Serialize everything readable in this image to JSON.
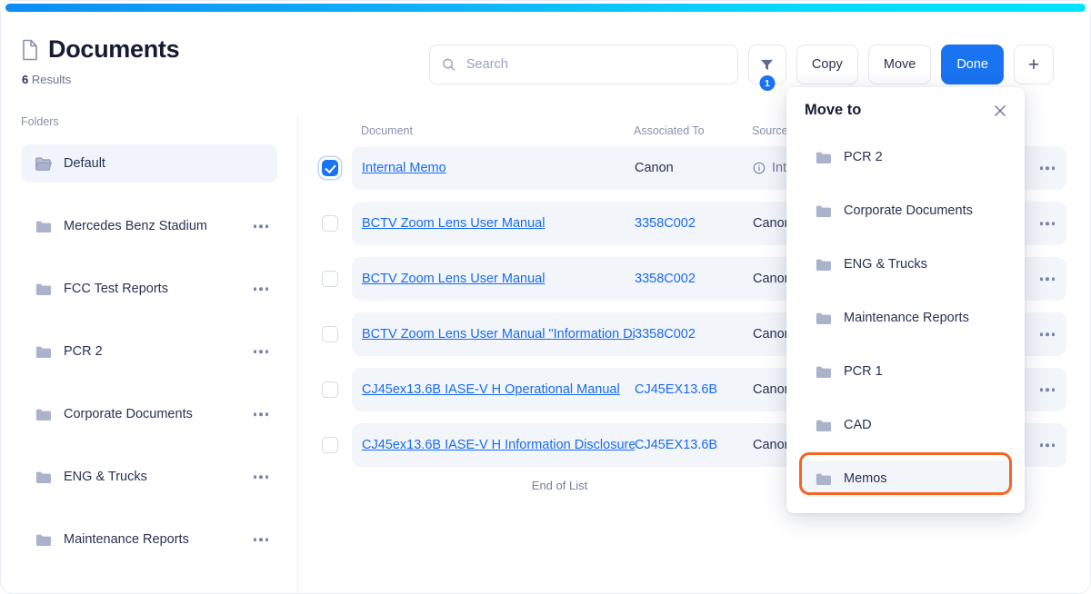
{
  "theme": {
    "accent_blue": "#1a73f0",
    "link_blue": "#1a6bf0",
    "highlight_orange": "#f26522",
    "row_bg": "#f2f5fa",
    "gradient_from": "#0d8df4",
    "gradient_to": "#00e5ff"
  },
  "header": {
    "title": "Documents",
    "results_count": "6",
    "results_label": "Results",
    "doc_icon": "document-icon"
  },
  "toolbar": {
    "search_placeholder": "Search",
    "search_value": "",
    "search_icon": "search-icon",
    "filter_icon": "filter-icon",
    "filter_badge": "1",
    "copy_label": "Copy",
    "move_label": "Move",
    "done_label": "Done",
    "add_label": "+"
  },
  "sidebar": {
    "label": "Folders",
    "items": [
      {
        "label": "Default",
        "active": true,
        "has_menu": false,
        "icon": "folder-open-icon"
      },
      {
        "label": "Mercedes Benz Stadium",
        "active": false,
        "has_menu": true,
        "icon": "folder-icon"
      },
      {
        "label": "FCC Test Reports",
        "active": false,
        "has_menu": true,
        "icon": "folder-icon"
      },
      {
        "label": "PCR 2",
        "active": false,
        "has_menu": true,
        "icon": "folder-icon"
      },
      {
        "label": "Corporate Documents",
        "active": false,
        "has_menu": true,
        "icon": "folder-icon"
      },
      {
        "label": "ENG & Trucks",
        "active": false,
        "has_menu": true,
        "icon": "folder-icon"
      },
      {
        "label": "Maintenance Reports",
        "active": false,
        "has_menu": true,
        "icon": "folder-icon"
      }
    ]
  },
  "table": {
    "columns": {
      "document": "Document",
      "associated_to": "Associated To",
      "source": "Source"
    },
    "rows": [
      {
        "checked": true,
        "document": "Internal Memo",
        "associated_to": "Canon",
        "associated_is_link": false,
        "source": "Internal",
        "source_icon": "info-circle-icon",
        "source_muted": true
      },
      {
        "checked": false,
        "document": "BCTV Zoom Lens User Manual",
        "associated_to": "3358C002",
        "associated_is_link": true,
        "source": "Canon",
        "source_icon": "",
        "source_muted": false
      },
      {
        "checked": false,
        "document": "BCTV Zoom Lens User Manual",
        "associated_to": "3358C002",
        "associated_is_link": true,
        "source": "Canon",
        "source_icon": "",
        "source_muted": false
      },
      {
        "checked": false,
        "document": "BCTV Zoom Lens User Manual \"Information Disclosure\"",
        "associated_to": "3358C002",
        "associated_is_link": true,
        "source": "Canon",
        "source_icon": "",
        "source_muted": false
      },
      {
        "checked": false,
        "document": "CJ45ex13.6B IASE-V H Operational Manual",
        "associated_to": "CJ45EX13.6B",
        "associated_is_link": true,
        "source": "Canon",
        "source_icon": "",
        "source_muted": false
      },
      {
        "checked": false,
        "document": "CJ45ex13.6B IASE-V H Information Disclosure",
        "associated_to": "CJ45EX13.6B",
        "associated_is_link": true,
        "source": "Canon",
        "source_icon": "",
        "source_muted": false
      }
    ],
    "end_of_list": "End of List",
    "row_menu_icon": "more-options-icon"
  },
  "move_popup": {
    "title": "Move to",
    "close_icon": "close-icon",
    "items": [
      {
        "label": "PCR 2",
        "highlighted": false
      },
      {
        "label": "Corporate Documents",
        "highlighted": false
      },
      {
        "label": "ENG & Trucks",
        "highlighted": false
      },
      {
        "label": "Maintenance Reports",
        "highlighted": false
      },
      {
        "label": "PCR 1",
        "highlighted": false
      },
      {
        "label": "CAD",
        "highlighted": false
      },
      {
        "label": "Memos",
        "highlighted": true
      }
    ]
  }
}
